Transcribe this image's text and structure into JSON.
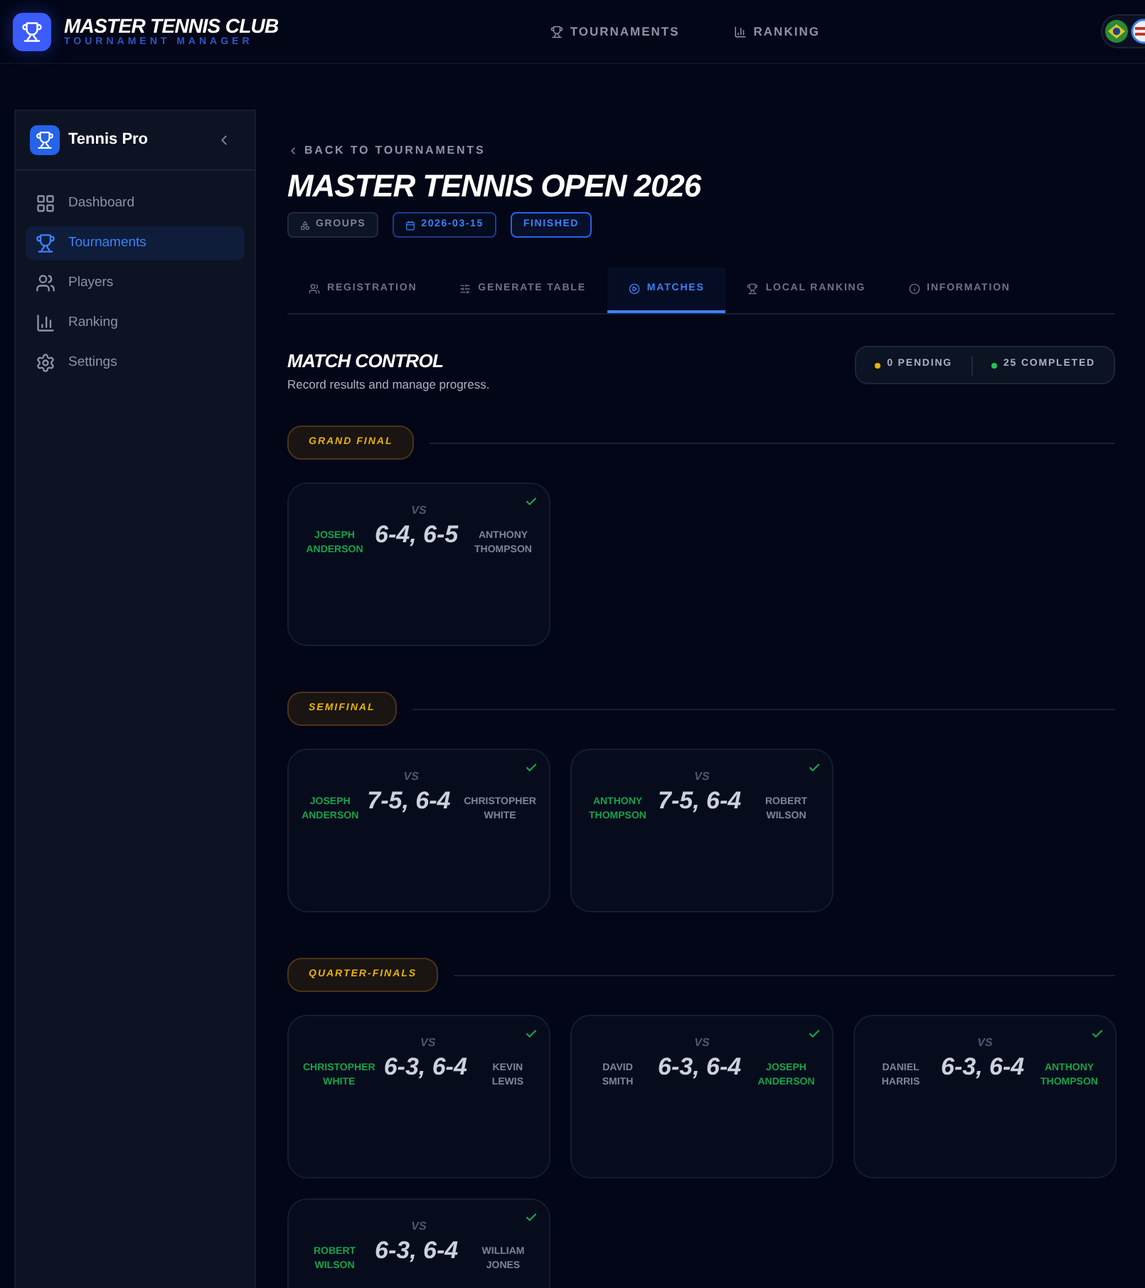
{
  "header": {
    "title": "MASTER TENNIS CLUB",
    "subtitle": "TOURNAMENT MANAGER",
    "nav": [
      {
        "label": "TOURNAMENTS"
      },
      {
        "label": "RANKING"
      }
    ]
  },
  "sidebar": {
    "brand": "Tennis Pro",
    "items": [
      {
        "label": "Dashboard",
        "selected": false
      },
      {
        "label": "Tournaments",
        "selected": true
      },
      {
        "label": "Players",
        "selected": false
      },
      {
        "label": "Ranking",
        "selected": false
      },
      {
        "label": "Settings",
        "selected": false
      }
    ]
  },
  "back_link": "BACK TO TOURNAMENTS",
  "title": "MASTER TENNIS OPEN 2026",
  "badges": [
    {
      "label": "GROUPS",
      "kind": "format"
    },
    {
      "label": "2026-03-15",
      "kind": "date"
    },
    {
      "label": "FINISHED",
      "kind": "status"
    }
  ],
  "tabs": [
    {
      "label": "REGISTRATION",
      "selected": false
    },
    {
      "label": "GENERATE TABLE",
      "selected": false
    },
    {
      "label": "MATCHES",
      "selected": true
    },
    {
      "label": "LOCAL RANKING",
      "selected": false
    },
    {
      "label": "INFORMATION",
      "selected": false
    }
  ],
  "section": {
    "title": "MATCH CONTROL",
    "subtitle": "Record results and manage progress."
  },
  "stats": [
    {
      "label": "0 PENDING",
      "color": "#eab308"
    },
    {
      "label": "25 COMPLETED",
      "color": "#22c55e"
    }
  ],
  "rounds": [
    {
      "name": "GRAND FINAL",
      "matches": [
        {
          "players": [
            {
              "name": "JOSEPH ANDERSON",
              "winner": true
            },
            {
              "name": "ANTHONY THOMPSON",
              "winner": false
            }
          ],
          "vs": "VS",
          "score": "6-4, 6-5",
          "completed": true
        }
      ]
    },
    {
      "name": "SEMIFINAL",
      "matches": [
        {
          "players": [
            {
              "name": "JOSEPH ANDERSON",
              "winner": true
            },
            {
              "name": "CHRISTOPHER WHITE",
              "winner": false
            }
          ],
          "vs": "VS",
          "score": "7-5, 6-4",
          "completed": true
        },
        {
          "players": [
            {
              "name": "ANTHONY THOMPSON",
              "winner": true
            },
            {
              "name": "ROBERT WILSON",
              "winner": false
            }
          ],
          "vs": "VS",
          "score": "7-5, 6-4",
          "completed": true
        }
      ]
    },
    {
      "name": "QUARTER-FINALS",
      "matches": [
        {
          "players": [
            {
              "name": "CHRISTOPHER WHITE",
              "winner": true
            },
            {
              "name": "KEVIN LEWIS",
              "winner": false
            }
          ],
          "vs": "VS",
          "score": "6-3, 6-4",
          "completed": true
        },
        {
          "players": [
            {
              "name": "DAVID SMITH",
              "winner": false
            },
            {
              "name": "JOSEPH ANDERSON",
              "winner": true
            }
          ],
          "vs": "VS",
          "score": "6-3, 6-4",
          "completed": true
        },
        {
          "players": [
            {
              "name": "DANIEL HARRIS",
              "winner": false
            },
            {
              "name": "ANTHONY THOMPSON",
              "winner": true
            }
          ],
          "vs": "VS",
          "score": "6-3, 6-4",
          "completed": true
        },
        {
          "players": [
            {
              "name": "ROBERT WILSON",
              "winner": true
            },
            {
              "name": "WILLIAM JONES",
              "winner": false
            }
          ],
          "vs": "VS",
          "score": "6-3, 6-4",
          "completed": true
        }
      ]
    }
  ]
}
